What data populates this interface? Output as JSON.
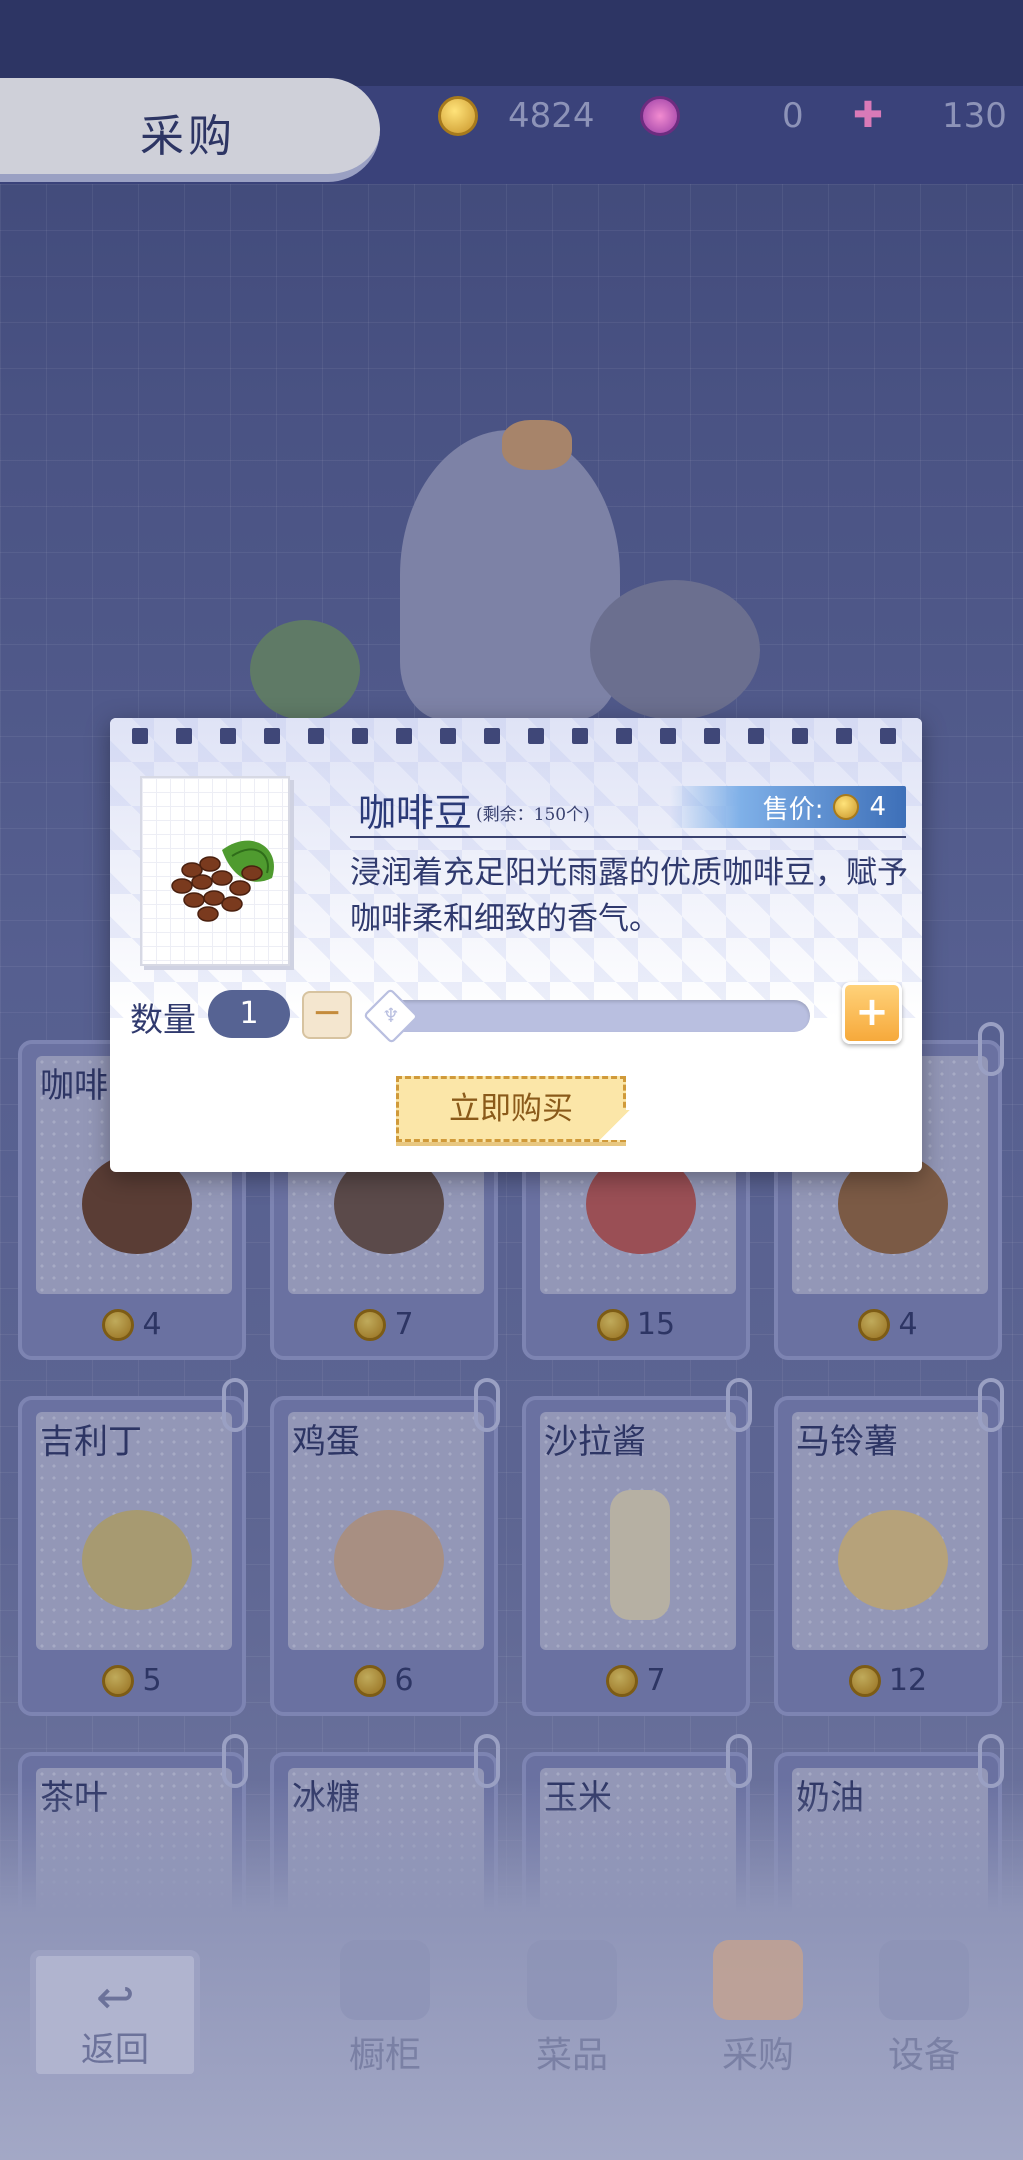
{
  "header": {
    "title": "采购",
    "coins": "4824",
    "gems": "0",
    "swans": "130"
  },
  "items": [
    {
      "name": "咖啡",
      "price": "4"
    },
    {
      "name": "",
      "price": "7"
    },
    {
      "name": "",
      "price": "15"
    },
    {
      "name": "",
      "price": "4"
    },
    {
      "name": "吉利丁",
      "price": "5"
    },
    {
      "name": "鸡蛋",
      "price": "6"
    },
    {
      "name": "沙拉酱",
      "price": "7"
    },
    {
      "name": "马铃薯",
      "price": "12"
    },
    {
      "name": "茶叶",
      "price": ""
    },
    {
      "name": "冰糖",
      "price": ""
    },
    {
      "name": "玉米",
      "price": ""
    },
    {
      "name": "奶油",
      "price": ""
    }
  ],
  "dialog": {
    "item_name": "咖啡豆",
    "stock": "(剩余：150个)",
    "price_label": "售价:",
    "price": "4",
    "description": "浸润着充足阳光雨露的优质咖啡豆，赋予咖啡柔和细致的香气。",
    "quantity_label": "数量",
    "quantity": "1",
    "minus": "−",
    "plus": "+",
    "buy_label": "立即购买"
  },
  "nav": {
    "back": "返回",
    "items": [
      {
        "label": "橱柜",
        "icon": "cabinet-icon"
      },
      {
        "label": "菜品",
        "icon": "burger-icon"
      },
      {
        "label": "采购",
        "icon": "shopping-bag-icon"
      },
      {
        "label": "设备",
        "icon": "machine-icon"
      }
    ]
  },
  "colors": {
    "accent": "#f6a93b",
    "primary": "#3a4270",
    "price_tag": "#3d6fb8"
  }
}
